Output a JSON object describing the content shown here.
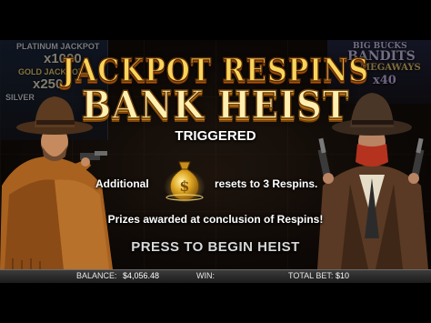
{
  "jackpots": {
    "platinum_label": "PLATINUM JACKPOT",
    "platinum_value": "x1000",
    "gold_label": "GOLD JACKPOT",
    "gold_value": "x250",
    "silver_label": "SILVER"
  },
  "big_bucks": {
    "line1": "BIG BUCKS",
    "line2": "BANDITS",
    "line3": "MEGAWAYS",
    "value": "x40"
  },
  "title": {
    "line1": "JACKPOT RESPINS",
    "line2": "BANK HEIST"
  },
  "overlay": {
    "triggered": "TRIGGERED",
    "info_prefix": "Additional",
    "info_suffix": "resets to 3 Respins.",
    "prizes": "Prizes awarded at conclusion of Respins!",
    "press_to_begin": "PRESS TO BEGIN HEIST"
  },
  "status_bar": {
    "balance_label": "BALANCE:",
    "balance_value": "$4,056.48",
    "win_label": "WIN:",
    "win_value": "",
    "total_bet_label": "TOTAL BET:",
    "total_bet_value": "$10"
  },
  "colors": {
    "title_gold": "#f8d55a",
    "title_cream": "#fff0b0",
    "bandit_scarf": "#b5321f",
    "bag_gold": "#e0a823"
  },
  "icons": {
    "money_bag": "money-bag-icon"
  }
}
